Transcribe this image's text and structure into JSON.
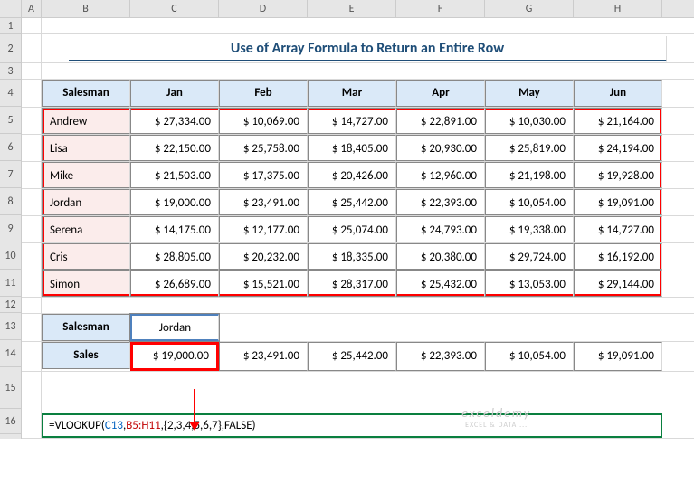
{
  "title": "Use of Array Formula to Return an Entire Row",
  "columns": [
    "A",
    "B",
    "C",
    "D",
    "E",
    "F",
    "G",
    "H"
  ],
  "row_numbers": [
    "1",
    "2",
    "3",
    "4",
    "5",
    "6",
    "7",
    "8",
    "9",
    "10",
    "11",
    "12",
    "13",
    "14",
    "15",
    "16"
  ],
  "headers": [
    "Salesman",
    "Jan",
    "Feb",
    "Mar",
    "Apr",
    "May",
    "Jun"
  ],
  "chart_data": {
    "type": "table",
    "columns": [
      "Salesman",
      "Jan",
      "Feb",
      "Mar",
      "Apr",
      "May",
      "Jun"
    ],
    "rows": [
      {
        "name": "Andrew",
        "values": [
          "$  27,334.00",
          "$  10,069.00",
          "$  14,727.00",
          "$  22,891.00",
          "$  10,030.00",
          "$  21,164.00"
        ]
      },
      {
        "name": "Lisa",
        "values": [
          "$  22,150.00",
          "$  25,758.00",
          "$  18,405.00",
          "$  20,930.00",
          "$  25,819.00",
          "$  24,194.00"
        ]
      },
      {
        "name": "Mike",
        "values": [
          "$  21,503.00",
          "$  17,375.00",
          "$  20,426.00",
          "$  12,960.00",
          "$  21,198.00",
          "$  19,928.00"
        ]
      },
      {
        "name": "Jordan",
        "values": [
          "$  19,000.00",
          "$  23,491.00",
          "$  25,442.00",
          "$  22,393.00",
          "$  10,054.00",
          "$  19,091.00"
        ]
      },
      {
        "name": "Serena",
        "values": [
          "$  14,175.00",
          "$  12,177.00",
          "$  25,074.00",
          "$  24,793.00",
          "$  19,338.00",
          "$  14,727.00"
        ]
      },
      {
        "name": "Cris",
        "values": [
          "$  28,805.00",
          "$  20,232.00",
          "$  18,335.00",
          "$  20,380.00",
          "$  29,724.00",
          "$  16,192.00"
        ]
      },
      {
        "name": "Simon",
        "values": [
          "$  26,689.00",
          "$  15,521.00",
          "$  28,317.00",
          "$  25,432.00",
          "$  13,053.00",
          "$  29,144.00"
        ]
      }
    ]
  },
  "lookup": {
    "salesman_label": "Salesman",
    "salesman_value": "Jordan",
    "sales_label": "Sales",
    "results": [
      "$  19,000.00",
      "$  23,491.00",
      "$  25,442.00",
      "$  22,393.00",
      "$  10,054.00",
      "$  19,091.00"
    ]
  },
  "formula": {
    "eq": "=VLOOKUP(",
    "arg1": "C13",
    "comma1": ",",
    "arg2": "B5:H11",
    "comma2": ",",
    "arg3": "{2,3,4,5,6,7}",
    "comma3": ",",
    "arg4": "FALSE",
    "close": ")"
  },
  "watermark": "exceldemy",
  "watermark_sub": "EXCEL & DATA ..."
}
